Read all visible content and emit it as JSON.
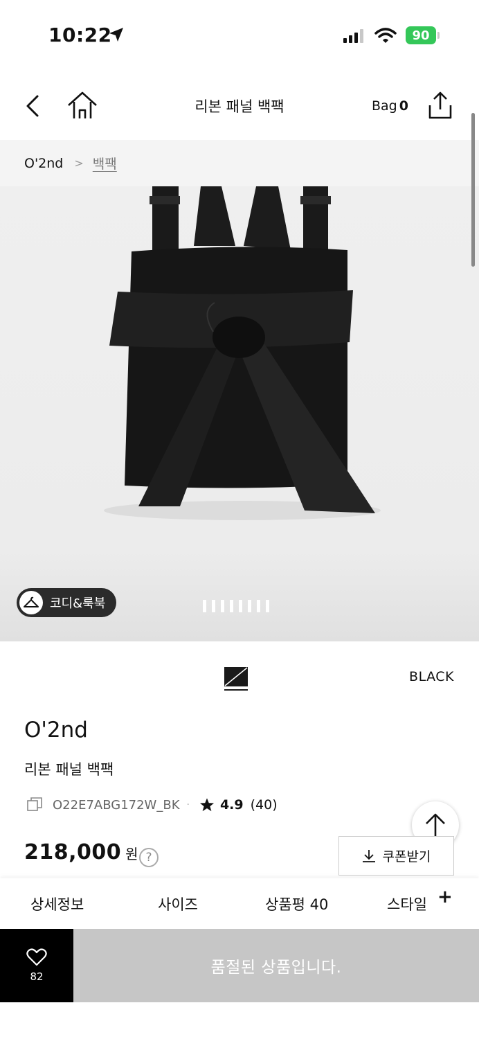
{
  "status_bar": {
    "time": "10:22",
    "battery": "90"
  },
  "header": {
    "title": "리본 패널 백팩",
    "bag_label": "Bag",
    "bag_count": "0"
  },
  "breadcrumb": {
    "brand": "O'2nd",
    "separator": ">",
    "category": "백팩"
  },
  "gallery": {
    "codi_label": "코디&룩북",
    "page_count": 8
  },
  "color": {
    "name": "BLACK"
  },
  "product": {
    "brand": "O'2nd",
    "name": "리본 패널 백팩",
    "sku": "O22E7ABG172W_BK",
    "separator": "·",
    "rating": "4.9",
    "review_count": "(40)",
    "price": "218,000",
    "currency": "원",
    "help": "?",
    "coupon_label": "쿠폰받기"
  },
  "tabs": [
    {
      "label": "상세정보"
    },
    {
      "label": "사이즈"
    },
    {
      "label": "상품평 40"
    },
    {
      "label": "스타일"
    }
  ],
  "tab_plus": "+",
  "bottom": {
    "wish_count": "82",
    "soldout_label": "품절된 상품입니다."
  },
  "colors": {
    "battery": "#34c759",
    "soldout_bg": "#c6c6c6",
    "wish_bg": "#000000"
  },
  "icons": {
    "back": "chevron-left-icon",
    "home": "home-icon",
    "share": "share-icon",
    "hanger": "hanger-icon",
    "copy": "copy-icon",
    "star": "star-icon",
    "download": "download-icon",
    "heart": "heart-icon",
    "top": "arrow-up-icon"
  }
}
